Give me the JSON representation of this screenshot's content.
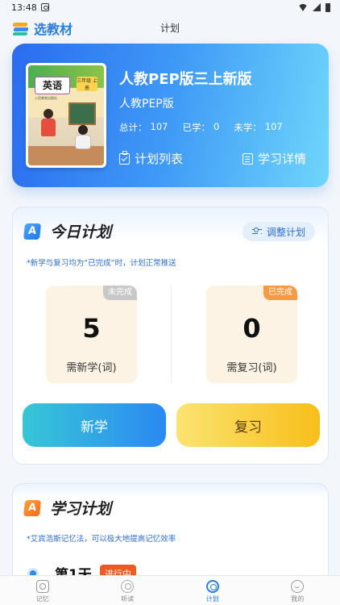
{
  "status_bar": {
    "time": "13:48"
  },
  "header": {
    "logo_text": "选教材",
    "title": "计划"
  },
  "book": {
    "cover": {
      "title": "英语",
      "grade": "三年级 上册",
      "publisher_small": "人民教育出版社"
    },
    "title": "人教PEP版三上新版",
    "edition": "人教PEP版",
    "stats": [
      {
        "label": "总计：",
        "value": "107"
      },
      {
        "label": "已学：",
        "value": "0"
      },
      {
        "label": "未学：",
        "value": "107"
      }
    ],
    "actions": {
      "plan_list": "计划列表",
      "study_detail": "学习详情"
    }
  },
  "today": {
    "badge": "A",
    "title": "今日计划",
    "adjust_label": "调整计划",
    "note": "*新学与复习均为“已完成”时，计划正常推送",
    "new_words": {
      "tag": "未完成",
      "count": "5",
      "label": "需新学(词)"
    },
    "review_words": {
      "tag": "已完成",
      "count": "0",
      "label": "需复习(词)"
    },
    "study_button": "新学",
    "review_button": "复习"
  },
  "plan": {
    "badge": "A",
    "title": "学习计划",
    "note": "*艾宾浩斯记忆法，可以极大地提高记忆效率",
    "day_label": "第1天",
    "day_status": "进行中"
  },
  "tabbar": {
    "items": [
      {
        "label": "记忆",
        "icon": "memory-icon"
      },
      {
        "label": "听读",
        "icon": "listen-icon"
      },
      {
        "label": "计划",
        "icon": "plan-icon"
      },
      {
        "label": "我的",
        "icon": "mine-icon"
      }
    ],
    "active": "计划",
    "accent": "#2a7de1"
  },
  "colors": {
    "accent": "#2a7de1",
    "orange": "#f69a43",
    "card_gradient_start": "#2a6cf0",
    "card_gradient_end": "#6fd6fb"
  }
}
